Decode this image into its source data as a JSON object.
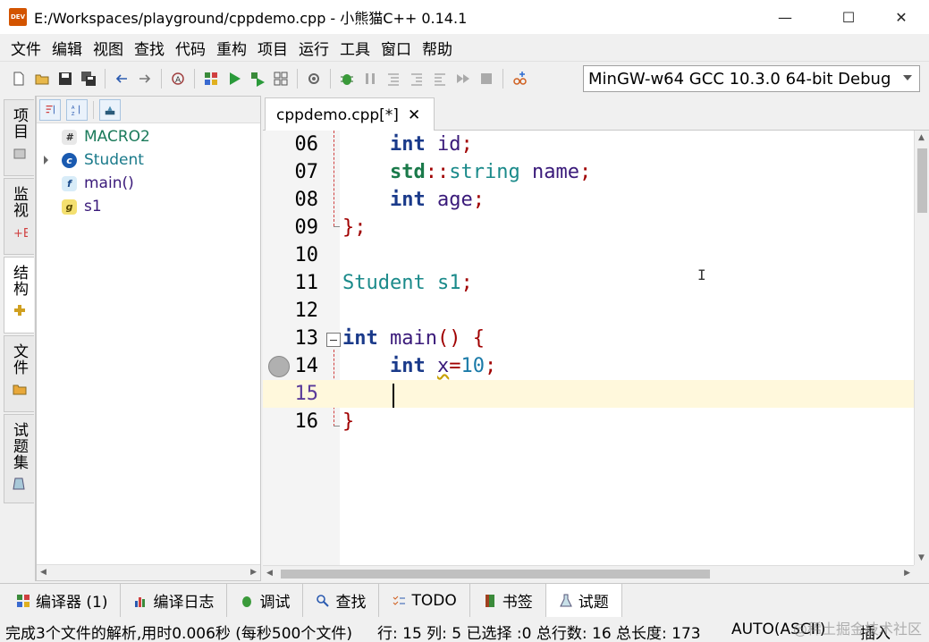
{
  "window": {
    "title": "E:/Workspaces/playground/cppdemo.cpp  - 小熊猫C++ 0.14.1",
    "app_icon_text": "DEV",
    "minimize": "—",
    "maximize": "☐",
    "close": "✕"
  },
  "menu": [
    "文件",
    "编辑",
    "视图",
    "查找",
    "代码",
    "重构",
    "项目",
    "运行",
    "工具",
    "窗口",
    "帮助"
  ],
  "toolbar": {
    "compiler_selected": "MinGW-w64 GCC 10.3.0 64-bit Debug"
  },
  "left_tabs": [
    {
      "label": "项目",
      "icon": "project-icon"
    },
    {
      "label": "监视",
      "icon": "watch-icon"
    },
    {
      "label": "结构",
      "icon": "structure-icon"
    },
    {
      "label": "文件",
      "icon": "folder-icon"
    },
    {
      "label": "试题集",
      "icon": "problem-set-icon"
    }
  ],
  "class_browser": {
    "items": [
      {
        "badge": "#",
        "label": "MACRO2",
        "kind": "macro"
      },
      {
        "badge": "c",
        "label": "Student",
        "kind": "class"
      },
      {
        "badge": "f",
        "label": "main()",
        "kind": "function"
      },
      {
        "badge": "g",
        "label": "s1",
        "kind": "global"
      }
    ]
  },
  "editor": {
    "tab_label": "cppdemo.cpp[*]",
    "tab_close": "✕",
    "line_numbers": [
      "06",
      "07",
      "08",
      "09",
      "10",
      "11",
      "12",
      "13",
      "14",
      "15",
      "16"
    ],
    "lines": [
      [
        "    ",
        "int",
        " ",
        "id",
        ";"
      ],
      [
        "    ",
        "std",
        "::",
        "string",
        " ",
        "name",
        ";"
      ],
      [
        "    ",
        "int",
        " ",
        "age",
        ";"
      ],
      [
        "};"
      ],
      [
        ""
      ],
      [
        "Student",
        " ",
        "s1",
        ";"
      ],
      [
        ""
      ],
      [
        "int",
        " ",
        "main",
        "() {"
      ],
      [
        "    ",
        "int",
        " ",
        "x",
        "=",
        "10",
        ";"
      ],
      [
        ""
      ],
      [
        "}"
      ]
    ],
    "mouse_cursor": "I"
  },
  "bottom_tabs": [
    {
      "label": "编译器 (1)",
      "icon": "compiler-icon"
    },
    {
      "label": "编译日志",
      "icon": "log-icon"
    },
    {
      "label": "调试",
      "icon": "debug-icon"
    },
    {
      "label": "查找",
      "icon": "search-icon"
    },
    {
      "label": "TODO",
      "icon": "todo-icon"
    },
    {
      "label": "书签",
      "icon": "bookmark-icon"
    },
    {
      "label": "试题",
      "icon": "problem-icon"
    }
  ],
  "status": {
    "message": "完成3个文件的解析,用时0.006秒 (每秒500个文件)",
    "position": "行: 15 列: 5 已选择 :0 总行数: 16 总长度: 173",
    "encoding": "AUTO(ASCII)",
    "mode": "插入"
  },
  "watermark": "@稀土掘金技术社区",
  "colors": {
    "keyword": "#1a3a8a",
    "type": "#1a8a8a",
    "identifier": "#3a1a7a",
    "punctuation": "#a00000",
    "number": "#1a7aa8",
    "current_line": "#fff8dc"
  }
}
